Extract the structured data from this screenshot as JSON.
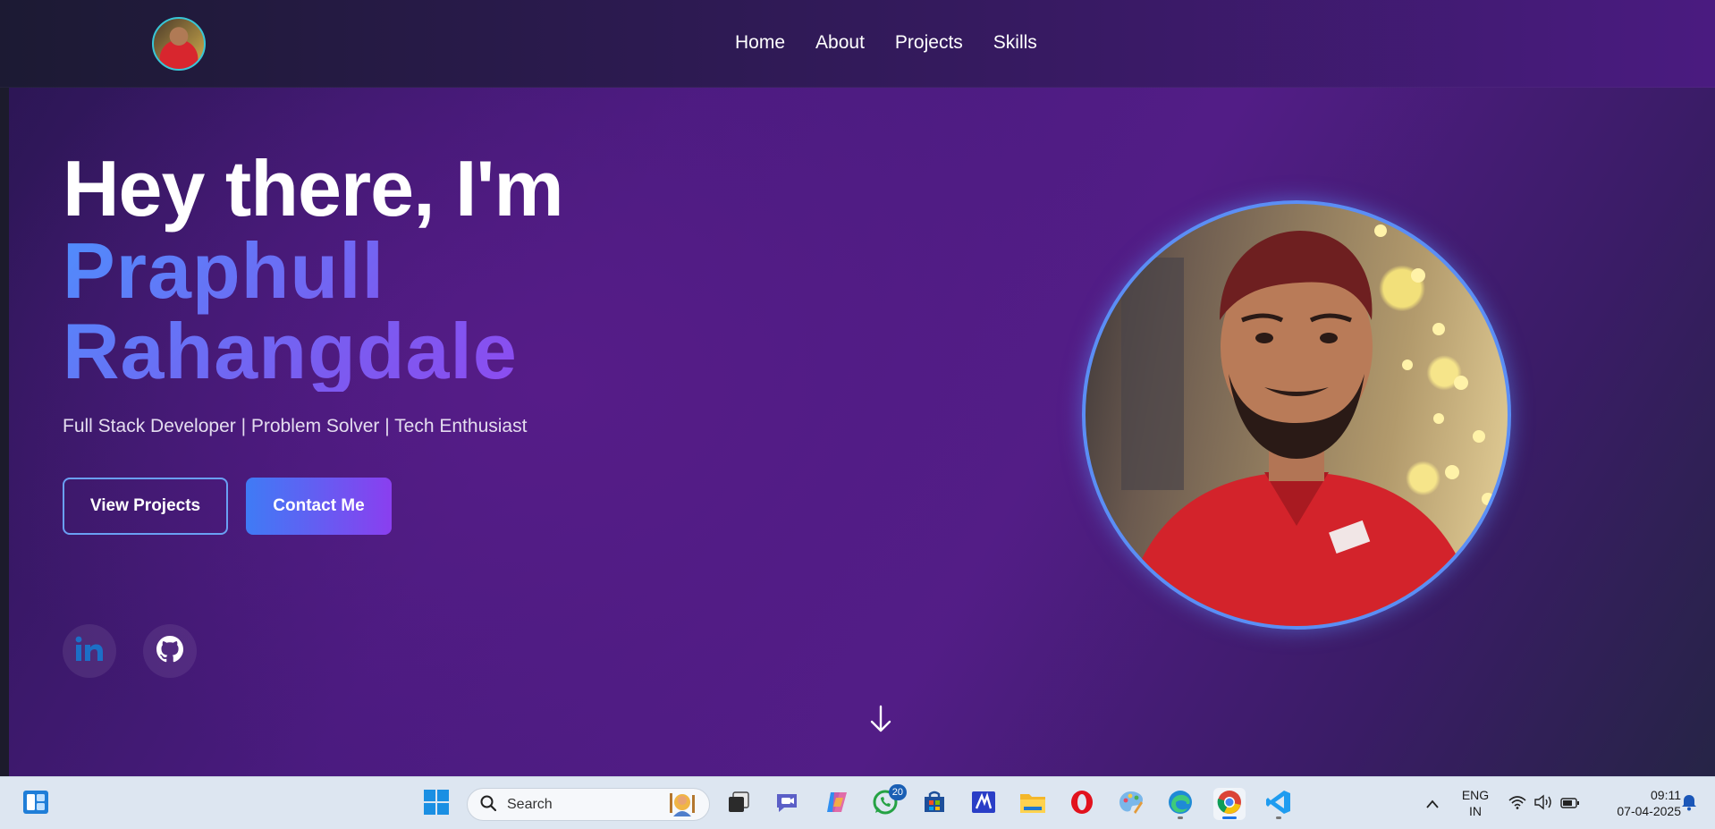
{
  "nav": {
    "links": [
      "Home",
      "About",
      "Projects",
      "Skills"
    ]
  },
  "hero": {
    "greeting": "Hey there, I'm",
    "name_line1": "Praphull",
    "name_line2": "Rahangdale",
    "subtitle": "Full Stack Developer | Problem Solver | Tech Enthusiast",
    "btn_projects": "View Projects",
    "btn_contact": "Contact Me"
  },
  "colors": {
    "accent_blue": "#4f8dfc",
    "accent_purple": "#9b3ef0",
    "portrait_ring": "#5b8ef5"
  },
  "icons": {
    "social": [
      "linkedin-icon",
      "github-icon"
    ],
    "scroll": "arrow-down-icon"
  },
  "taskbar": {
    "search_placeholder": "Search",
    "whatsapp_badge": "20",
    "lang_line1": "ENG",
    "lang_line2": "IN",
    "time": "09:11",
    "date": "07-04-2025",
    "apps": [
      "widgets",
      "start",
      "search",
      "task-view",
      "teams",
      "copilot",
      "whatsapp",
      "store",
      "mail",
      "file-explorer",
      "opera",
      "paint",
      "edge",
      "chrome",
      "vscode"
    ]
  }
}
